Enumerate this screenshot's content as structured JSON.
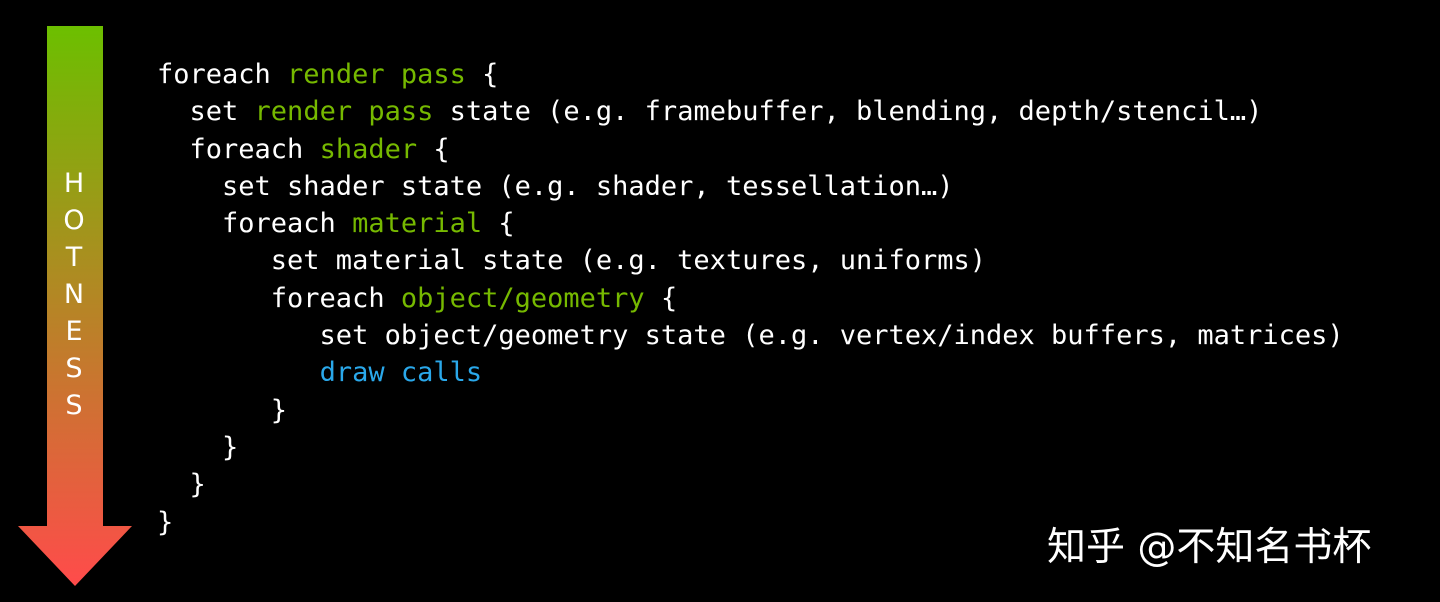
{
  "hotness_arrow": {
    "letters": [
      "H",
      "O",
      "T",
      "N",
      "E",
      "S",
      "S"
    ],
    "gradient_top_color": "#6cbf00",
    "gradient_bottom_color": "#ff4b4b"
  },
  "code_lines": [
    [
      {
        "text": "foreach "
      },
      {
        "text": "render pass",
        "color": "green"
      },
      {
        "text": " {"
      }
    ],
    [
      {
        "text": "  set "
      },
      {
        "text": "render pass",
        "color": "green"
      },
      {
        "text": " state (e.g. framebuffer, blending, depth/stencil…)"
      }
    ],
    [
      {
        "text": "  foreach "
      },
      {
        "text": "shader",
        "color": "green"
      },
      {
        "text": " {"
      }
    ],
    [
      {
        "text": "    set shader state (e.g. shader, tessellation…)"
      }
    ],
    [
      {
        "text": "    foreach "
      },
      {
        "text": "material",
        "color": "green"
      },
      {
        "text": " {"
      }
    ],
    [
      {
        "text": "       set material state (e.g. textures, uniforms)"
      }
    ],
    [
      {
        "text": "       foreach "
      },
      {
        "text": "object/geometry",
        "color": "green"
      },
      {
        "text": " {"
      }
    ],
    [
      {
        "text": "          set object/geometry state (e.g. vertex/index buffers, matrices)"
      }
    ],
    [
      {
        "text": "          "
      },
      {
        "text": "draw calls",
        "color": "blue"
      }
    ],
    [
      {
        "text": "       }"
      }
    ],
    [
      {
        "text": "    }"
      }
    ],
    [
      {
        "text": "  }"
      }
    ],
    [
      {
        "text": "}"
      }
    ]
  ],
  "watermark": "知乎 @不知名书杯",
  "colors": {
    "background": "#000000",
    "text": "#ffffff",
    "keyword_green": "#76b900",
    "keyword_blue": "#2aa8ea"
  }
}
